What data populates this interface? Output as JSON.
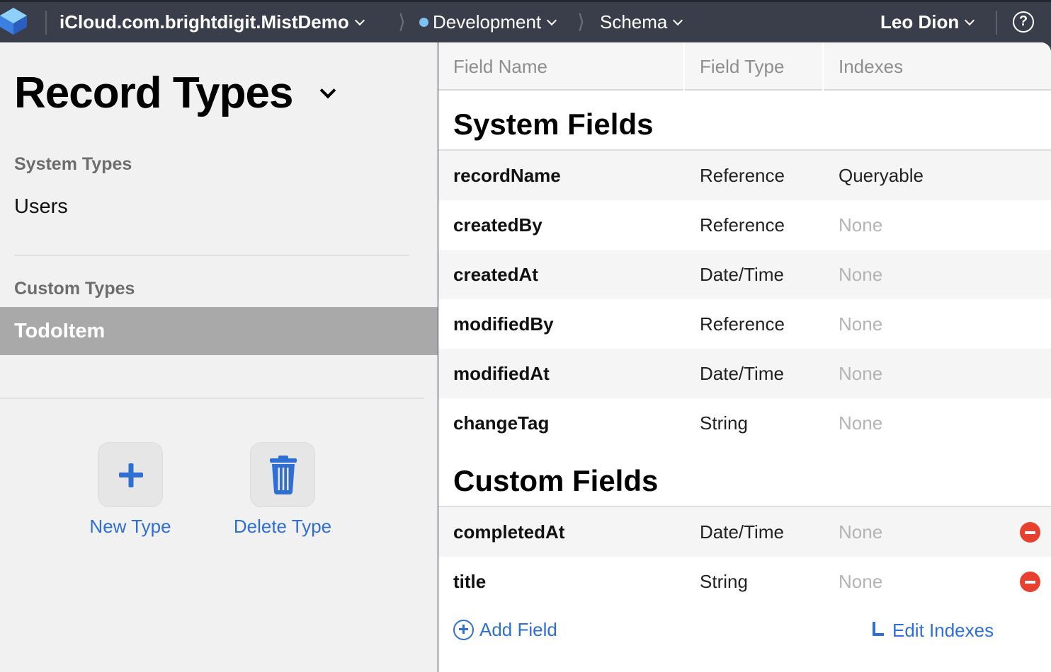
{
  "topbar": {
    "container": "iCloud.com.brightdigit.MistDemo",
    "environment": "Development",
    "environment_dot_color": "#7dc0f2",
    "section": "Schema",
    "user": "Leo Dion",
    "help_glyph": "?"
  },
  "sidebar": {
    "title": "Record Types",
    "system_label": "System Types",
    "system_items": [
      {
        "label": "Users"
      }
    ],
    "custom_label": "Custom Types",
    "custom_items": [
      {
        "label": "TodoItem",
        "selected": true
      }
    ],
    "actions": {
      "new_type": "New Type",
      "delete_type": "Delete Type"
    }
  },
  "table": {
    "columns": [
      "Field Name",
      "Field Type",
      "Indexes"
    ],
    "system_section": "System Fields",
    "system_fields": [
      {
        "name": "recordName",
        "type": "Reference",
        "indexes": "Queryable"
      },
      {
        "name": "createdBy",
        "type": "Reference",
        "indexes": "None"
      },
      {
        "name": "createdAt",
        "type": "Date/Time",
        "indexes": "None"
      },
      {
        "name": "modifiedBy",
        "type": "Reference",
        "indexes": "None"
      },
      {
        "name": "modifiedAt",
        "type": "Date/Time",
        "indexes": "None"
      },
      {
        "name": "changeTag",
        "type": "String",
        "indexes": "None"
      }
    ],
    "custom_section": "Custom Fields",
    "custom_fields": [
      {
        "name": "completedAt",
        "type": "Date/Time",
        "indexes": "None"
      },
      {
        "name": "title",
        "type": "String",
        "indexes": "None"
      }
    ],
    "add_field": "Add Field",
    "edit_indexes": "Edit Indexes"
  },
  "colors": {
    "accent": "#2f6fd4",
    "remove": "#e8402f",
    "topbar": "#3a3e4b",
    "selected_row": "#a9a9a9"
  }
}
